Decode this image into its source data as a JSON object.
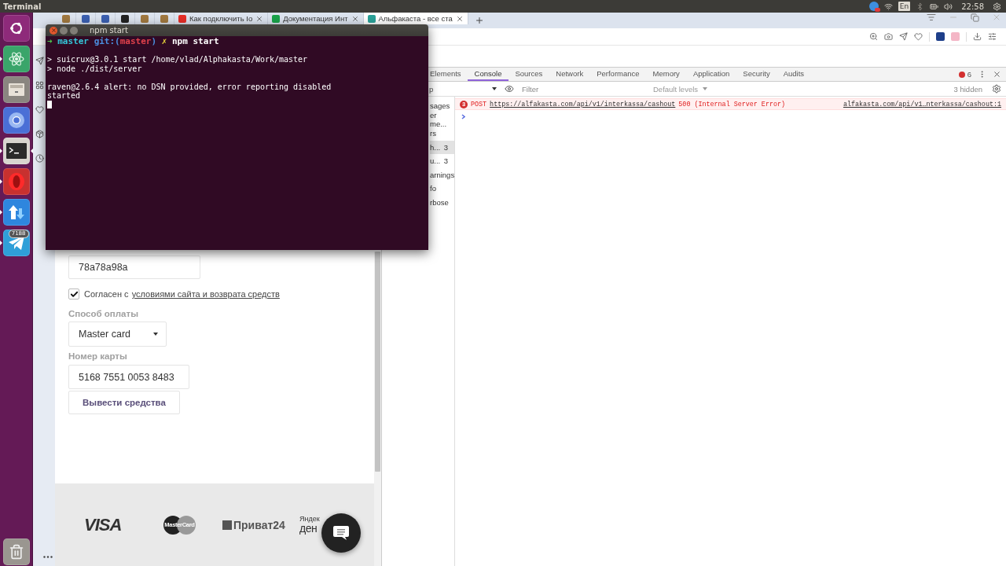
{
  "top_panel": {
    "title": "Terminal",
    "keyboard_layout": "En",
    "clock": "22:58"
  },
  "launcher": {
    "apps": [
      {
        "kind": "ubuntu",
        "running": false,
        "focused": false
      },
      {
        "kind": "atom",
        "running": true,
        "focused": false
      },
      {
        "kind": "files",
        "running": false,
        "focused": false
      },
      {
        "kind": "chromium",
        "running": false,
        "focused": false
      },
      {
        "kind": "terminal",
        "running": true,
        "focused": true
      },
      {
        "kind": "opera",
        "running": true,
        "focused": false
      },
      {
        "kind": "transfer",
        "running": true,
        "focused": false
      },
      {
        "kind": "telegram",
        "running": true,
        "focused": false,
        "badge": "7188"
      }
    ]
  },
  "browser": {
    "tabs": [
      {
        "kind": "pinned",
        "selected": false,
        "color": "#a07840"
      },
      {
        "kind": "pinned",
        "selected": false,
        "color": "#3b5fb0"
      },
      {
        "kind": "pinned",
        "selected": false,
        "color": "#3b5fb0"
      },
      {
        "kind": "pinned",
        "selected": false,
        "color": "#222222"
      },
      {
        "kind": "pinned",
        "selected": false,
        "color": "#a07840"
      },
      {
        "kind": "pinned",
        "selected": false,
        "color": "#a07840"
      },
      {
        "kind": "page",
        "title": "Как подключить Io",
        "selected": false,
        "color": "#e52d27"
      },
      {
        "kind": "page",
        "title": "Документация Инт",
        "selected": false,
        "color": "#1aa34a"
      },
      {
        "kind": "page",
        "title": "Альфакаста - все ста",
        "selected": true,
        "color": "#2aa198"
      }
    ]
  },
  "terminal": {
    "title": "npm start",
    "prompt": [
      {
        "text": "➜",
        "color": "#4ec94e"
      },
      {
        "text": "master",
        "color": "#34c6d9"
      },
      {
        "text": "git:(",
        "color": "#4b8fe0"
      },
      {
        "text": "master",
        "color": "#e0414b"
      },
      {
        "text": ")",
        "color": "#4b8fe0"
      },
      {
        "text": "✗",
        "color": "#e6d23a"
      },
      {
        "text": "npm start",
        "color": "#ffffff"
      }
    ],
    "output": [
      {
        "lines": [
          "> suicrux@3.0.1 start /home/vlad/Alphakasta/Work/master",
          "> node ./dist/server"
        ]
      },
      {
        "lines": [
          "raven@2.6.4 alert: no DSN provided, error reporting disabled",
          "started"
        ]
      }
    ],
    "cursor": true
  },
  "page": {
    "code_value": "78a78a98a",
    "agree": {
      "checked": true,
      "text": "Согласен с",
      "link": "условиями сайта и возврата средств"
    },
    "payment_label": "Способ оплаты",
    "payment_value": "Master card",
    "card_label": "Номер карты",
    "card_value": "5168 7551 0053 8483",
    "submit": "Вывести средства",
    "footer": {
      "visa": "VISA",
      "mastercard": "MasterCard",
      "privat": "Приват24",
      "yandex_top": "Яндек",
      "yandex_bottom": "ден"
    }
  },
  "devtools": {
    "tabs": [
      {
        "label": "Elements",
        "selected": false
      },
      {
        "label": "Console",
        "selected": true
      },
      {
        "label": "Sources",
        "selected": false
      },
      {
        "label": "Network",
        "selected": false
      },
      {
        "label": "Performance",
        "selected": false
      },
      {
        "label": "Memory",
        "selected": false
      },
      {
        "label": "Application",
        "selected": false
      },
      {
        "label": "Security",
        "selected": false
      },
      {
        "label": "Audits",
        "selected": false
      }
    ],
    "error_count": "6",
    "context": "p",
    "filter_placeholder": "Filter",
    "levels": "Default levels",
    "hidden": "3 hidden",
    "sidebar": [
      {
        "label": "sages",
        "selected": false
      },
      {
        "label": "er me...",
        "selected": false
      },
      {
        "label": "rs",
        "selected": false
      },
      {
        "label": "h...",
        "count": "3",
        "selected": true
      },
      {
        "label": "u...",
        "count": "3",
        "selected": false
      },
      {
        "label": "arnings",
        "selected": false
      },
      {
        "label": "fo",
        "selected": false
      },
      {
        "label": "rbose",
        "selected": false
      }
    ],
    "messages": [
      {
        "kind": "error",
        "count": "3",
        "method": "POST",
        "url": "https://alfakasta.com/api/v1/interkassa/cashout",
        "status": "500 (Internal Server Error)",
        "source": "alfakasta.com/api/v1…nterkassa/cashout:1"
      }
    ]
  }
}
